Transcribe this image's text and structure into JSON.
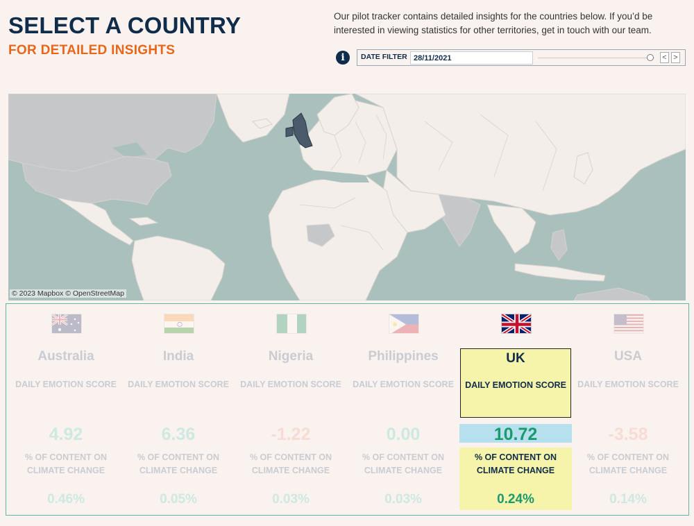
{
  "header": {
    "title": "SELECT A COUNTRY",
    "subtitle": "FOR DETAILED INSIGHTS",
    "intro": "Our pilot tracker contains detailed insights for the countries below. If you’d be interested in viewing statistics for other territories, get in touch with our team."
  },
  "date_filter": {
    "label": "DATE FILTER",
    "value": "28/11/2021",
    "prev": "<",
    "next": ">"
  },
  "map": {
    "credit": "© 2023 Mapbox  © OpenStreetMap",
    "highlighted_country": "UK",
    "colors": {
      "water": "#aac0bd",
      "land": "#f3eee9",
      "highlight": "#4a5a6a"
    }
  },
  "labels": {
    "metric": "DAILY EMOTION SCORE",
    "pct": "% OF CONTENT ON CLIMATE CHANGE"
  },
  "countries": [
    {
      "name": "Australia",
      "score": "4.92",
      "pct": "0.46%",
      "flag": "australia-flag-icon"
    },
    {
      "name": "India",
      "score": "6.36",
      "pct": "0.05%",
      "flag": "india-flag-icon"
    },
    {
      "name": "Nigeria",
      "score": "-1.22",
      "pct": "0.03%",
      "flag": "nigeria-flag-icon"
    },
    {
      "name": "Philippines",
      "score": "0.00",
      "pct": "0.03%",
      "flag": "philippines-flag-icon"
    },
    {
      "name": "UK",
      "score": "10.72",
      "pct": "0.24%",
      "flag": "uk-flag-icon",
      "selected": true
    },
    {
      "name": "USA",
      "score": "-3.58",
      "pct": "0.14%",
      "flag": "usa-flag-icon"
    }
  ],
  "colors": {
    "title": "#0f2d4a",
    "accent": "#e8661a",
    "panel_border": "#5fb8a6",
    "selected_bg": "#f6f3aa",
    "selected_score_bg": "#b7e0ef",
    "positive": "#1a9a6e"
  }
}
